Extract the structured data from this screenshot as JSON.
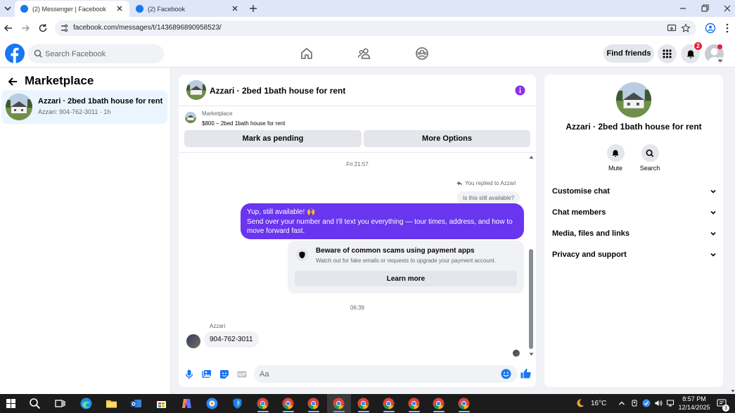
{
  "browser": {
    "tabs": [
      {
        "title": "(2) Messenger | Facebook",
        "active": true
      },
      {
        "title": "(2) Facebook",
        "active": false
      }
    ],
    "url": "facebook.com/messages/t/1436896890958523/"
  },
  "fb_header": {
    "search_placeholder": "Search Facebook",
    "find_friends_label": "Find friends",
    "notification_count": "2"
  },
  "left_panel": {
    "title": "Marketplace",
    "conversation": {
      "title": "Azzari · 2bed 1bath house for rent",
      "preview": "Azzari: 904-762-3011 · 1h"
    }
  },
  "chat": {
    "header_title": "Azzari · 2bed 1bath house for rent",
    "listing": {
      "source": "Marketplace",
      "price_title": "$800 – 2bed 1bath house for rent"
    },
    "actions": {
      "mark_pending": "Mark as pending",
      "more_options": "More Options"
    },
    "messages": {
      "timestamp_1": "Fri 21:57",
      "replied_label": "You replied to Azzari",
      "quoted_text": "Is this still available?",
      "outgoing_line1": "Yup, still available! 🙌",
      "outgoing_line2": "Send over your number and I'll text you everything — tour times, address, and how to move forward fast.",
      "scam_title": "Beware of common scams using payment apps",
      "scam_desc": "Watch out for fake emails or requests to upgrade your payment account.",
      "learn_more": "Learn more",
      "timestamp_2": "06:39",
      "sender_name": "Azzari",
      "incoming_text": "904-762-3011"
    },
    "composer_placeholder": "Aa"
  },
  "right_panel": {
    "title": "Azzari · 2bed 1bath house for rent",
    "mute_label": "Mute",
    "search_label": "Search",
    "sections": [
      "Customise chat",
      "Chat members",
      "Media, files and links",
      "Privacy and support"
    ]
  },
  "taskbar": {
    "temperature": "16°C",
    "time": "8:57 PM",
    "date": "12/14/2025",
    "notification_count": "3"
  },
  "colors": {
    "fb_blue": "#1877f2",
    "bubble_purple": "#6935ee",
    "badge_red": "#e41e3f"
  }
}
